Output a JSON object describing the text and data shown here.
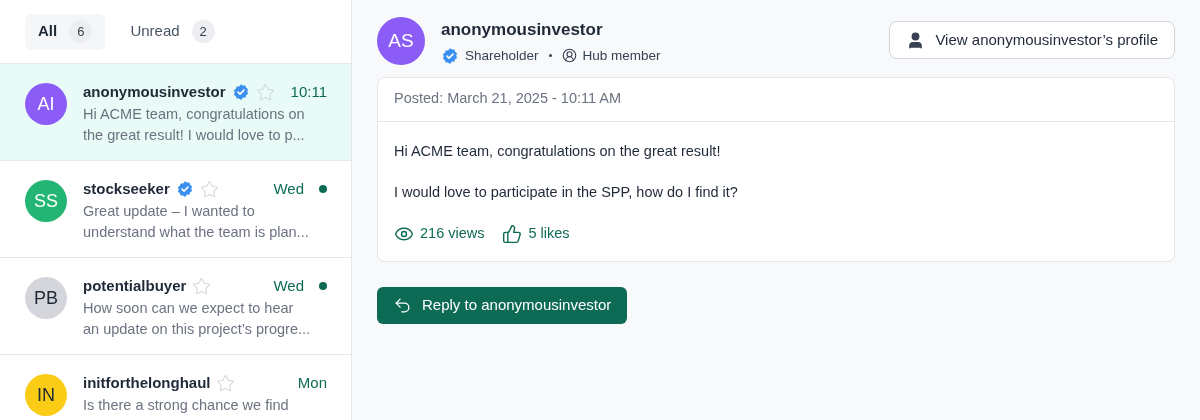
{
  "tabs": [
    {
      "label": "All",
      "count": "6",
      "selected": true
    },
    {
      "label": "Unread",
      "count": "2",
      "selected": false
    }
  ],
  "conversations": [
    {
      "initials": "AI",
      "color": "#8b5cf6",
      "name": "anonymousinvestor",
      "verified": true,
      "starred": false,
      "time": "10:11",
      "unread": false,
      "selected": true,
      "preview_lines": [
        "Hi ACME team, congratulations on",
        "the great result! I would love to p..."
      ]
    },
    {
      "initials": "SS",
      "color": "#22b573",
      "name": "stockseeker",
      "verified": true,
      "starred": false,
      "time": "Wed",
      "unread": true,
      "selected": false,
      "preview_lines": [
        "Great update – I wanted to",
        "understand what the team is plan..."
      ]
    },
    {
      "initials": "PB",
      "color": "#d4d6db",
      "name": "potentialbuyer",
      "verified": false,
      "starred": false,
      "time": "Wed",
      "unread": true,
      "selected": false,
      "preview_lines": [
        "How soon can we expect to hear",
        "an update on this project’s progre..."
      ]
    },
    {
      "initials": "IN",
      "color": "#facc15",
      "name": "initforthelonghaul",
      "verified": false,
      "starred": false,
      "time": "Mon",
      "unread": false,
      "selected": false,
      "preview_lines": [
        "Is there a strong chance we find"
      ]
    }
  ],
  "detail": {
    "initials": "AS",
    "color": "#8b5cf6",
    "name": "anonymousinvestor",
    "role": "Shareholder",
    "verified": true,
    "membership": "Hub member",
    "profile_button": "View anonymousinvestor’s profile",
    "posted": "Posted: March 21, 2025 - 10:11 AM",
    "paragraphs": [
      "Hi ACME team, congratulations on the great result!",
      "I would love to participate in the SPP, how do I find it?"
    ],
    "views": "216 views",
    "likes": "5 likes",
    "reply_button": "Reply to anonymousinvestor"
  }
}
